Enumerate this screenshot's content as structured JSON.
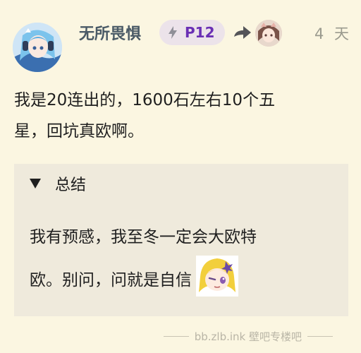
{
  "post": {
    "username": "无所畏惧",
    "flair": "P12",
    "time": "4 天",
    "body_line1": "我是20连出的，1600石左右10个五",
    "body_line2": "星，回坑真欧啊。",
    "details": {
      "summary": "总结",
      "content_line1": "我有预感，我至冬一定会大欧特",
      "content_line2": "欧。别问，问就是自信"
    }
  },
  "watermark": "bb.zlb.ink 壁吧专楼吧",
  "colors": {
    "background": "#fbf6e1",
    "username": "#4a5a66",
    "flair_bg": "#ece3ea",
    "flair_text": "#6a2fb4",
    "details_bg": "#efeadc",
    "muted": "#9a9a8e"
  },
  "icons": {
    "flair": "lightning-bolt-icon",
    "reply": "reply-arrow-icon",
    "summary": "triangle-down-icon"
  }
}
